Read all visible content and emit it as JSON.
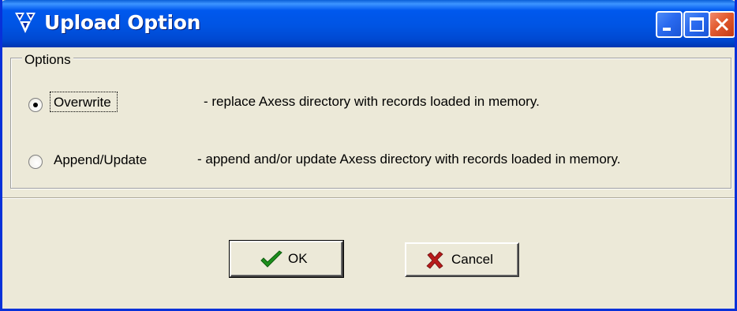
{
  "window": {
    "title": "Upload Option",
    "icon": "app-logo-icon"
  },
  "titlebar_buttons": {
    "minimize": "minimize-icon",
    "maximize": "maximize-icon",
    "close": "close-icon"
  },
  "options": {
    "group_label": "Options",
    "items": [
      {
        "label": "Overwrite",
        "description": "- replace Axess directory with records loaded in memory.",
        "selected": true
      },
      {
        "label": "Append/Update",
        "description": "- append and/or update Axess directory with records loaded in memory.",
        "selected": false
      }
    ]
  },
  "buttons": {
    "ok_label": "OK",
    "ok_icon": "checkmark-icon",
    "cancel_label": "Cancel",
    "cancel_icon": "x-mark-icon"
  },
  "colors": {
    "titlebar": "#0054e3",
    "window_face": "#ece9d8",
    "close_button": "#e25a2e",
    "ok_check": "#1c8f1c",
    "cancel_x": "#b81b1b"
  }
}
